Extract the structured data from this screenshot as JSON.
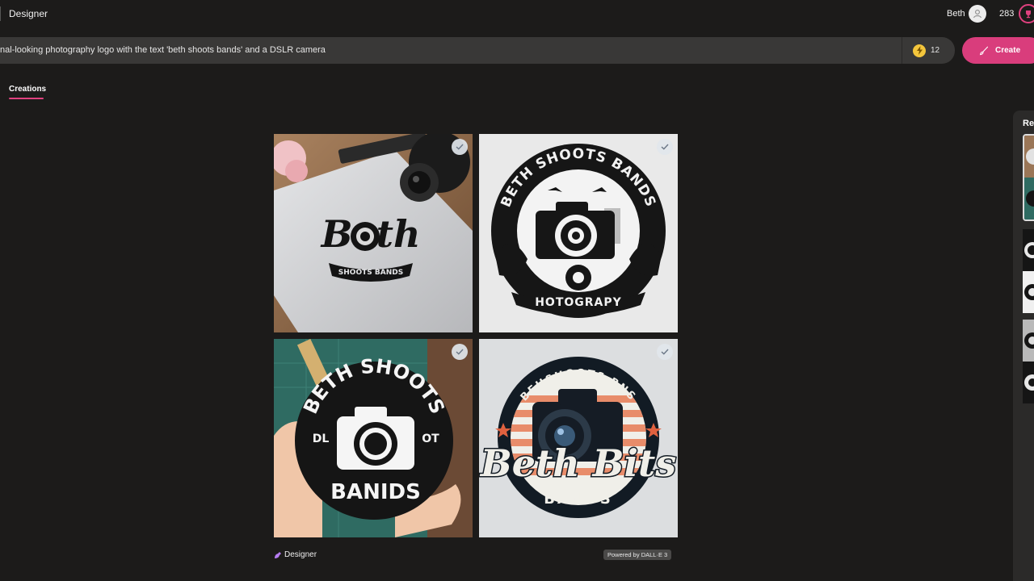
{
  "header": {
    "app_title": "Designer",
    "user_name": "Beth",
    "points": "283"
  },
  "prompt": {
    "text": "nal-looking photography logo with the text 'beth shoots bands' and a DSLR camera",
    "boosts": "12",
    "create_label": "Create"
  },
  "tabs": [
    {
      "label": "Creations",
      "active": true
    }
  ],
  "images": [
    {
      "id": "img1",
      "script": "Beth",
      "banner": "SHOOTS BANDS",
      "selected": true
    },
    {
      "id": "img2",
      "arc_text": "BETH SHOOTS BANDS",
      "bottom_text": "HOTOGRAPY",
      "selected": true
    },
    {
      "id": "img3",
      "arc_text": "BETH SHOOTS",
      "left_text": "DL",
      "right_text": "OT",
      "bottom_text": "BANIDS",
      "selected": true
    },
    {
      "id": "img4",
      "arc_text": "BEHSHOOTS BNS",
      "script": "Beth Bits",
      "bottom_text": "BANDS",
      "selected": true
    }
  ],
  "footer": {
    "brand": "Designer",
    "powered": "Powered by DALL·E 3"
  },
  "right_panel": {
    "title": "Re"
  },
  "colors": {
    "background": "#1c1b1a",
    "accent": "#d93d7c",
    "prompt_bar": "#393837"
  }
}
